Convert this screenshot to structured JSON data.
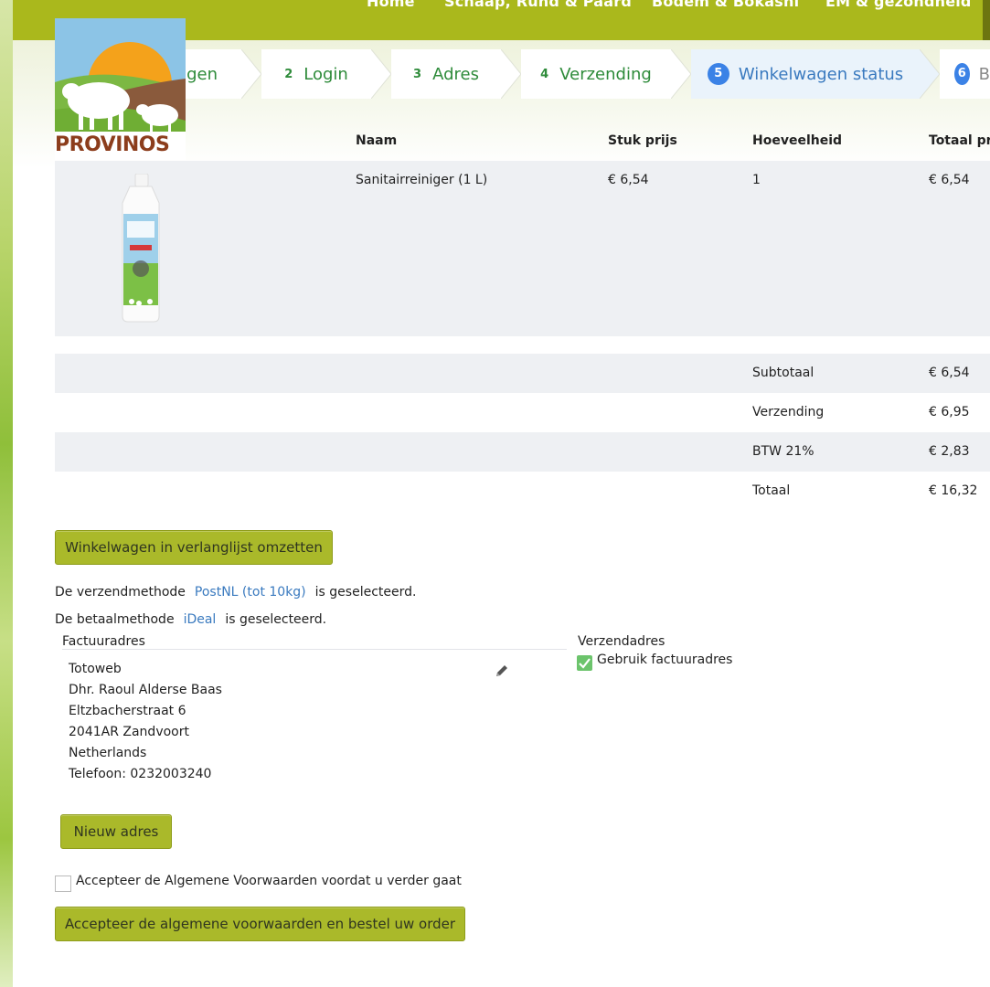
{
  "nav": {
    "items": [
      "Home",
      "Schaap, Rund & Paard",
      "Bodem & Bokashi",
      "EM & gezondheid"
    ]
  },
  "brand": {
    "logo_text": "PROVINOS"
  },
  "steps": [
    {
      "num": "",
      "label": "agen",
      "active": false
    },
    {
      "num": "2",
      "label": "Login",
      "active": false
    },
    {
      "num": "3",
      "label": "Adres",
      "active": false
    },
    {
      "num": "4",
      "label": "Verzending",
      "active": false
    },
    {
      "num": "5",
      "label": "Winkelwagen status",
      "active": true
    },
    {
      "num": "6",
      "label": "B",
      "active": false
    }
  ],
  "cart": {
    "headers": {
      "name": "Naam",
      "unit_price": "Stuk prijs",
      "quantity": "Hoeveelheid",
      "total": "Totaal pr"
    },
    "items": [
      {
        "name": "Sanitairreiniger (1 L)",
        "unit_price": "€ 6,54",
        "quantity": "1",
        "total": "€ 6,54"
      }
    ],
    "summary": [
      {
        "label": "Subtotaal",
        "value": "€ 6,54"
      },
      {
        "label": "Verzending",
        "value": "€ 6,95"
      },
      {
        "label": "BTW 21%",
        "value": "€ 2,83"
      },
      {
        "label": "Totaal",
        "value": "€ 16,32"
      }
    ]
  },
  "actions": {
    "wishlist_button": "Winkelwagen in verlanglijst omzetten",
    "new_address_button": "Nieuw adres",
    "order_button": "Accepteer de algemene voorwaarden en bestel uw order"
  },
  "shipping": {
    "prefix": "De verzendmethode",
    "method": "PostNL (tot 10kg)",
    "suffix": "is geselecteerd."
  },
  "payment": {
    "prefix": "De betaalmethode",
    "method": "iDeal",
    "suffix": "is geselecteerd."
  },
  "billing": {
    "title": "Factuuradres",
    "lines": [
      "Totoweb",
      "Dhr. Raoul Alderse Baas",
      "Eltzbacherstraat 6",
      "2041AR Zandvoort",
      "Netherlands",
      "Telefoon: 0232003240"
    ]
  },
  "delivery": {
    "title": "Verzendadres",
    "use_billing_label": "Gebruik factuuradres",
    "use_billing_checked": true
  },
  "terms": {
    "label": "Accepteer de Algemene Voorwaarden voordat u verder gaat",
    "checked": false
  },
  "colors": {
    "nav_bg": "#aab81c",
    "button_bg": "#aab92a",
    "step_active_bg": "#eaf3fb",
    "step_text": "#2e8b3a",
    "link": "#3a7abf",
    "row_shade": "#eef0f3"
  }
}
